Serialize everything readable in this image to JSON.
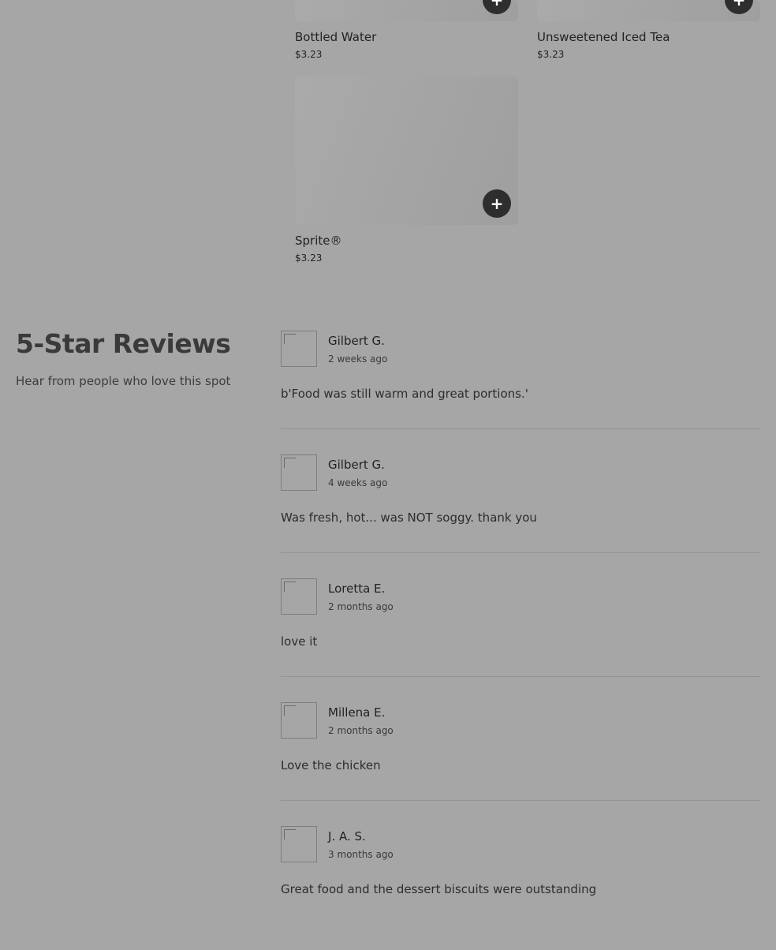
{
  "menu_items": [
    {
      "name": "Bottled Water",
      "price": "$3.23"
    },
    {
      "name": "Unsweetened Iced Tea",
      "price": "$3.23"
    },
    {
      "name": "Sprite®",
      "price": "$3.23"
    }
  ],
  "add_button_label": "+",
  "reviews_section": {
    "title": "5-Star Reviews",
    "subtitle": "Hear from people who love this spot"
  },
  "reviews": [
    {
      "name": "Gilbert G.",
      "time": "2 weeks ago",
      "text": "b'Food was still warm and great portions.'"
    },
    {
      "name": "Gilbert G.",
      "time": "4 weeks ago",
      "text": "Was fresh, hot... was NOT soggy. thank you"
    },
    {
      "name": "Loretta E.",
      "time": "2 months ago",
      "text": "love it"
    },
    {
      "name": "Millena E.",
      "time": "2 months ago",
      "text": "Love the chicken"
    },
    {
      "name": "J. A. S.",
      "time": "3 months ago",
      "text": "Great food and the dessert biscuits were outstanding"
    }
  ]
}
